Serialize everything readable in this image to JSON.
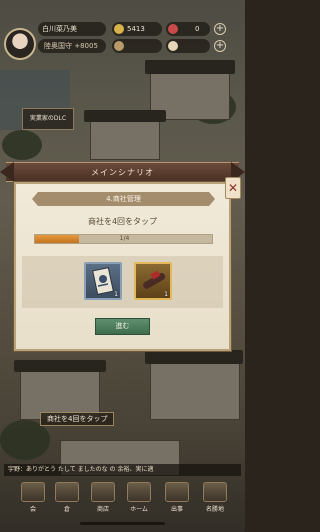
{
  "player": {
    "name": "白川菜乃美",
    "rank": "陸奥国守 +8005"
  },
  "resources": [
    {
      "name": "gold-coin-icon",
      "value": "5413",
      "color": "#d8b34a"
    },
    {
      "name": "gem-icon",
      "value": "0",
      "color": "#c84a4a"
    }
  ],
  "scene": {
    "left_panel_text": "実業家のDLC",
    "quest_prompt": "商社を4回をタップ",
    "chat_line": "宇野：ありがとう たして ましたのな の 余裕、実に適"
  },
  "dialog": {
    "header": "メインシナリオ",
    "chapter": "4.商社管理",
    "task": "商社を4回をタップ",
    "progress_label": "1/4",
    "progress_fraction": 0.25,
    "rewards": [
      {
        "name": "scroll-card-icon",
        "count": "1"
      },
      {
        "name": "ink-brush-icon",
        "count": "1"
      }
    ],
    "go_button": "進む",
    "close_label": "✕"
  },
  "nav": {
    "items": [
      "会",
      "倉",
      "商店",
      "ホーム",
      "出事",
      "名勝地"
    ]
  }
}
